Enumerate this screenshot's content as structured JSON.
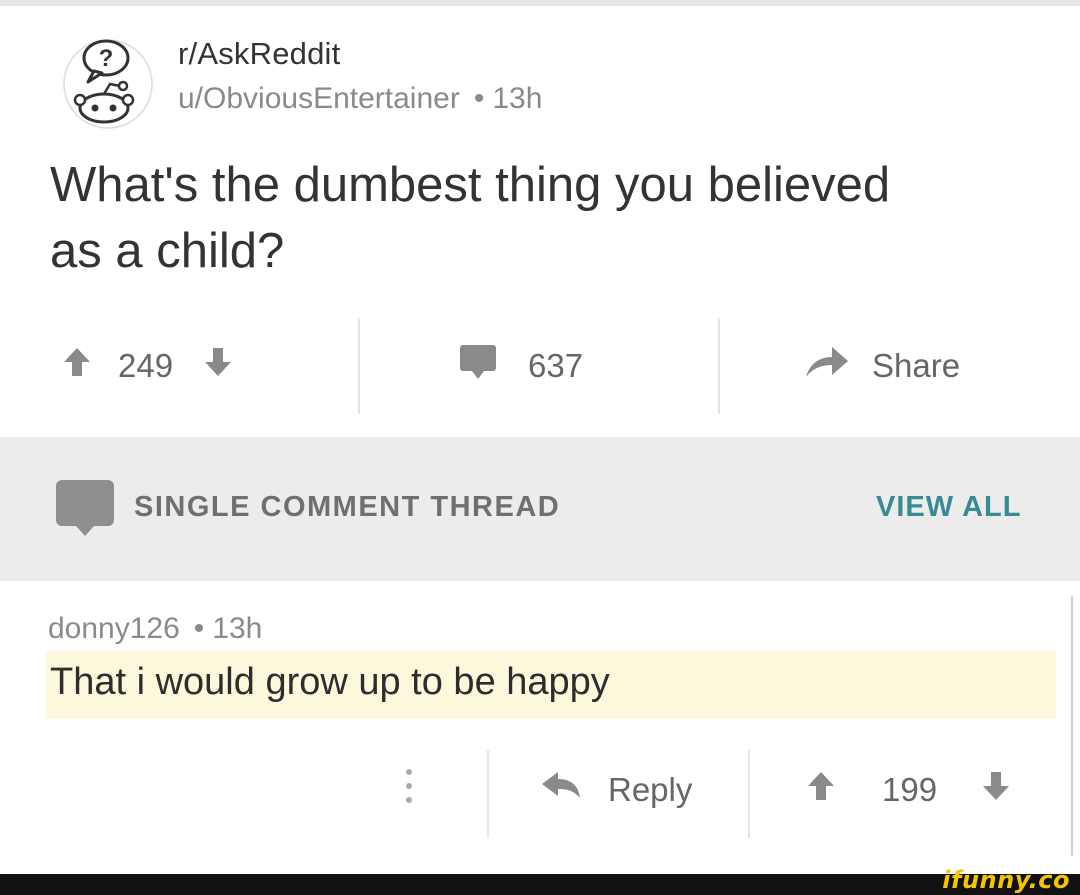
{
  "post": {
    "subreddit": "r/AskReddit",
    "author": "u/ObviousEntertainer",
    "age": "13h",
    "title": "What's the dumbest thing you believed as a child?",
    "score": "249",
    "comment_count": "637",
    "share_label": "Share"
  },
  "thread_bar": {
    "label": "SINGLE COMMENT THREAD",
    "view_all": "VIEW ALL"
  },
  "comment": {
    "author": "donny126",
    "age": "13h",
    "text": "That i would grow up to be happy",
    "reply_label": "Reply",
    "score": "199",
    "more_icon": "vertical-dots-icon"
  },
  "watermark": "ifunny.co",
  "colors": {
    "band": "#ececec",
    "highlight": "#fbf8dc",
    "view_all": "#3a8a93",
    "muted_text": "#8a8a8a",
    "watermark": "#f5c400"
  }
}
